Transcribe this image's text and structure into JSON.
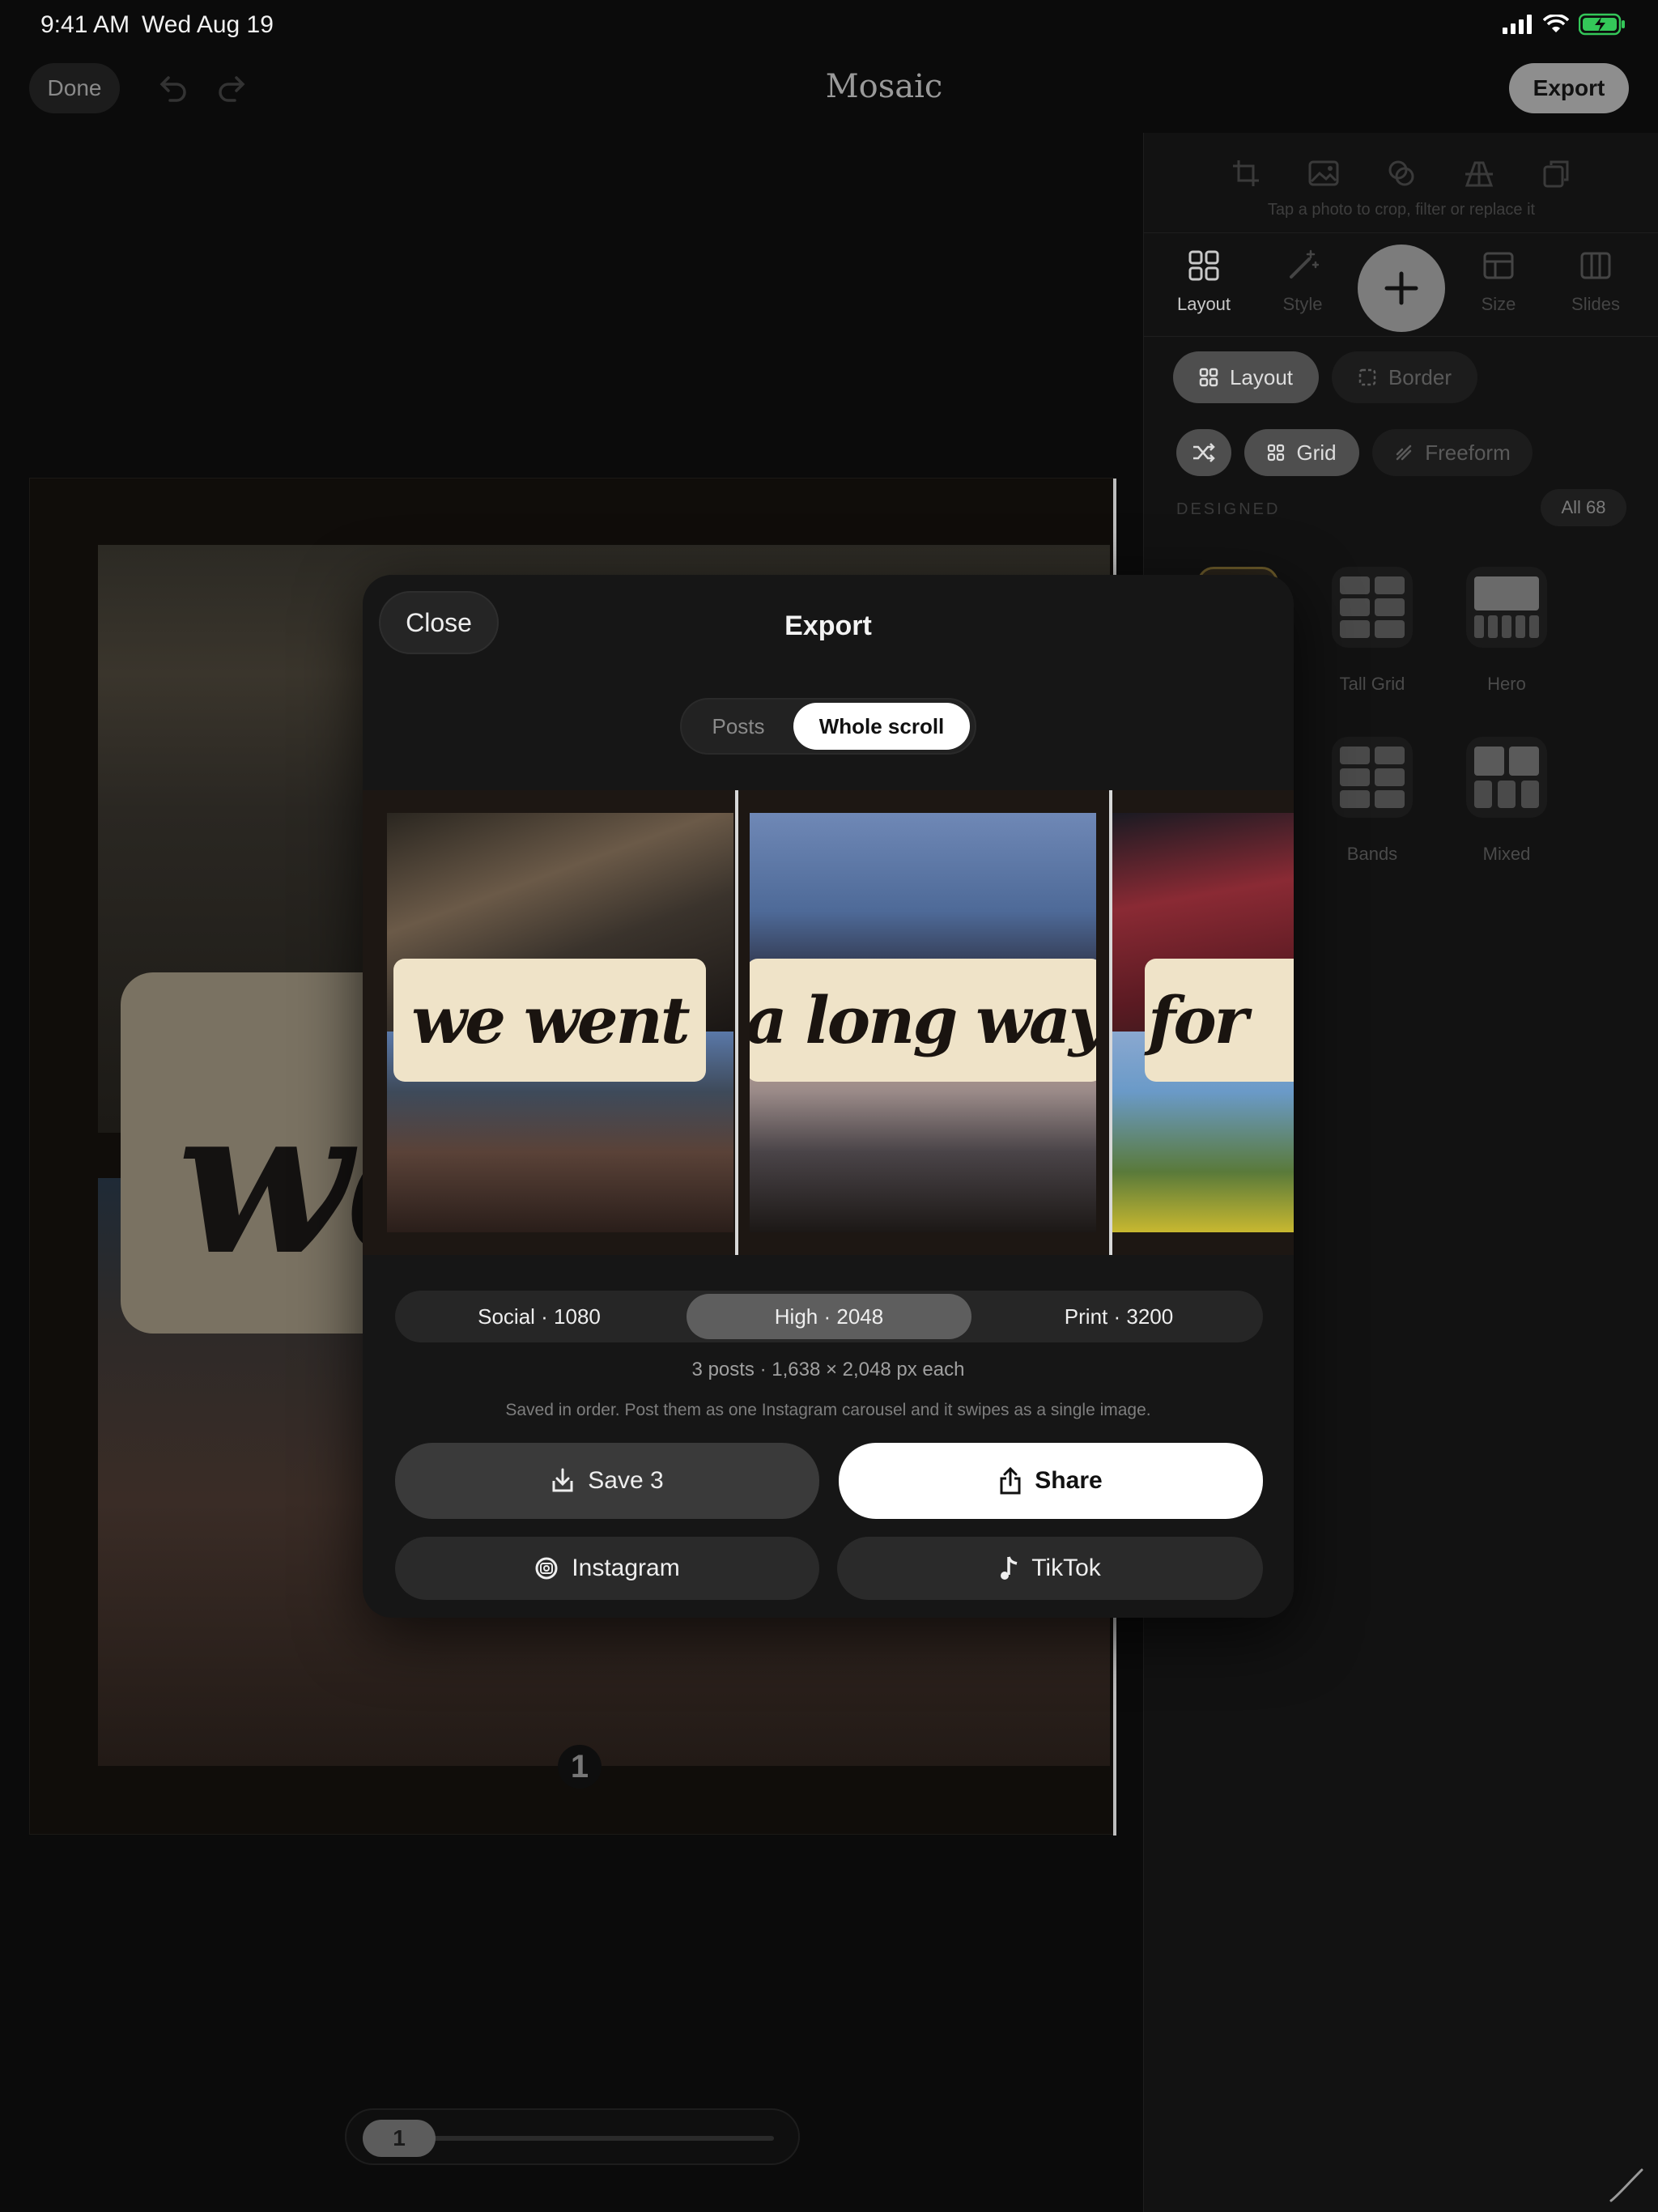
{
  "status_bar": {
    "time": "9:41 AM",
    "date": "Wed Aug 19"
  },
  "top_bar": {
    "done_label": "Done",
    "title": "Mosaic",
    "export_label": "Export"
  },
  "canvas": {
    "card_text": "we",
    "page_number": "1"
  },
  "page_slider": {
    "current": "1"
  },
  "panel": {
    "tool_hint": "Tap a photo to crop, filter or replace it",
    "tabs": [
      {
        "label": "Layout",
        "icon": "grid-icon",
        "active": true
      },
      {
        "label": "Style",
        "icon": "magic-wand-icon",
        "active": false
      },
      {
        "label": "Size",
        "icon": "size-icon",
        "active": false
      },
      {
        "label": "Slides",
        "icon": "slides-icon",
        "active": false
      }
    ],
    "subtabs": {
      "layout": "Layout",
      "border": "Border"
    },
    "modes": {
      "grid": "Grid",
      "freeform": "Freeform"
    },
    "section_label": "DESIGNED",
    "all_badge": "All 68",
    "layouts": [
      {
        "label": "Tall Grid",
        "icon": "tall-grid-icon"
      },
      {
        "label": "Hero",
        "icon": "hero-layout-icon"
      },
      {
        "label": "Bands",
        "icon": "bands-layout-icon"
      },
      {
        "label": "Mixed",
        "icon": "mixed-layout-icon"
      }
    ]
  },
  "export_modal": {
    "close_label": "Close",
    "title": "Export",
    "segments": {
      "posts": "Posts",
      "whole_scroll": "Whole scroll",
      "selected": "Whole scroll"
    },
    "slides": [
      {
        "text": "we went"
      },
      {
        "text": "a long way"
      },
      {
        "text": "for"
      }
    ],
    "quality_options": [
      "Social · 1080",
      "High · 2048",
      "Print · 3200"
    ],
    "quality_selected": "High · 2048",
    "summary": "3 posts · 1,638 × 2,048 px each",
    "note": "Saved in order. Post them as one Instagram carousel and it swipes as a single image.",
    "actions": {
      "save": "Save 3",
      "share": "Share",
      "instagram": "Instagram",
      "tiktok": "TikTok"
    }
  },
  "colors": {
    "accent_active": "#ffffff",
    "battery": "#34c759",
    "banner": "#efe3c8"
  }
}
